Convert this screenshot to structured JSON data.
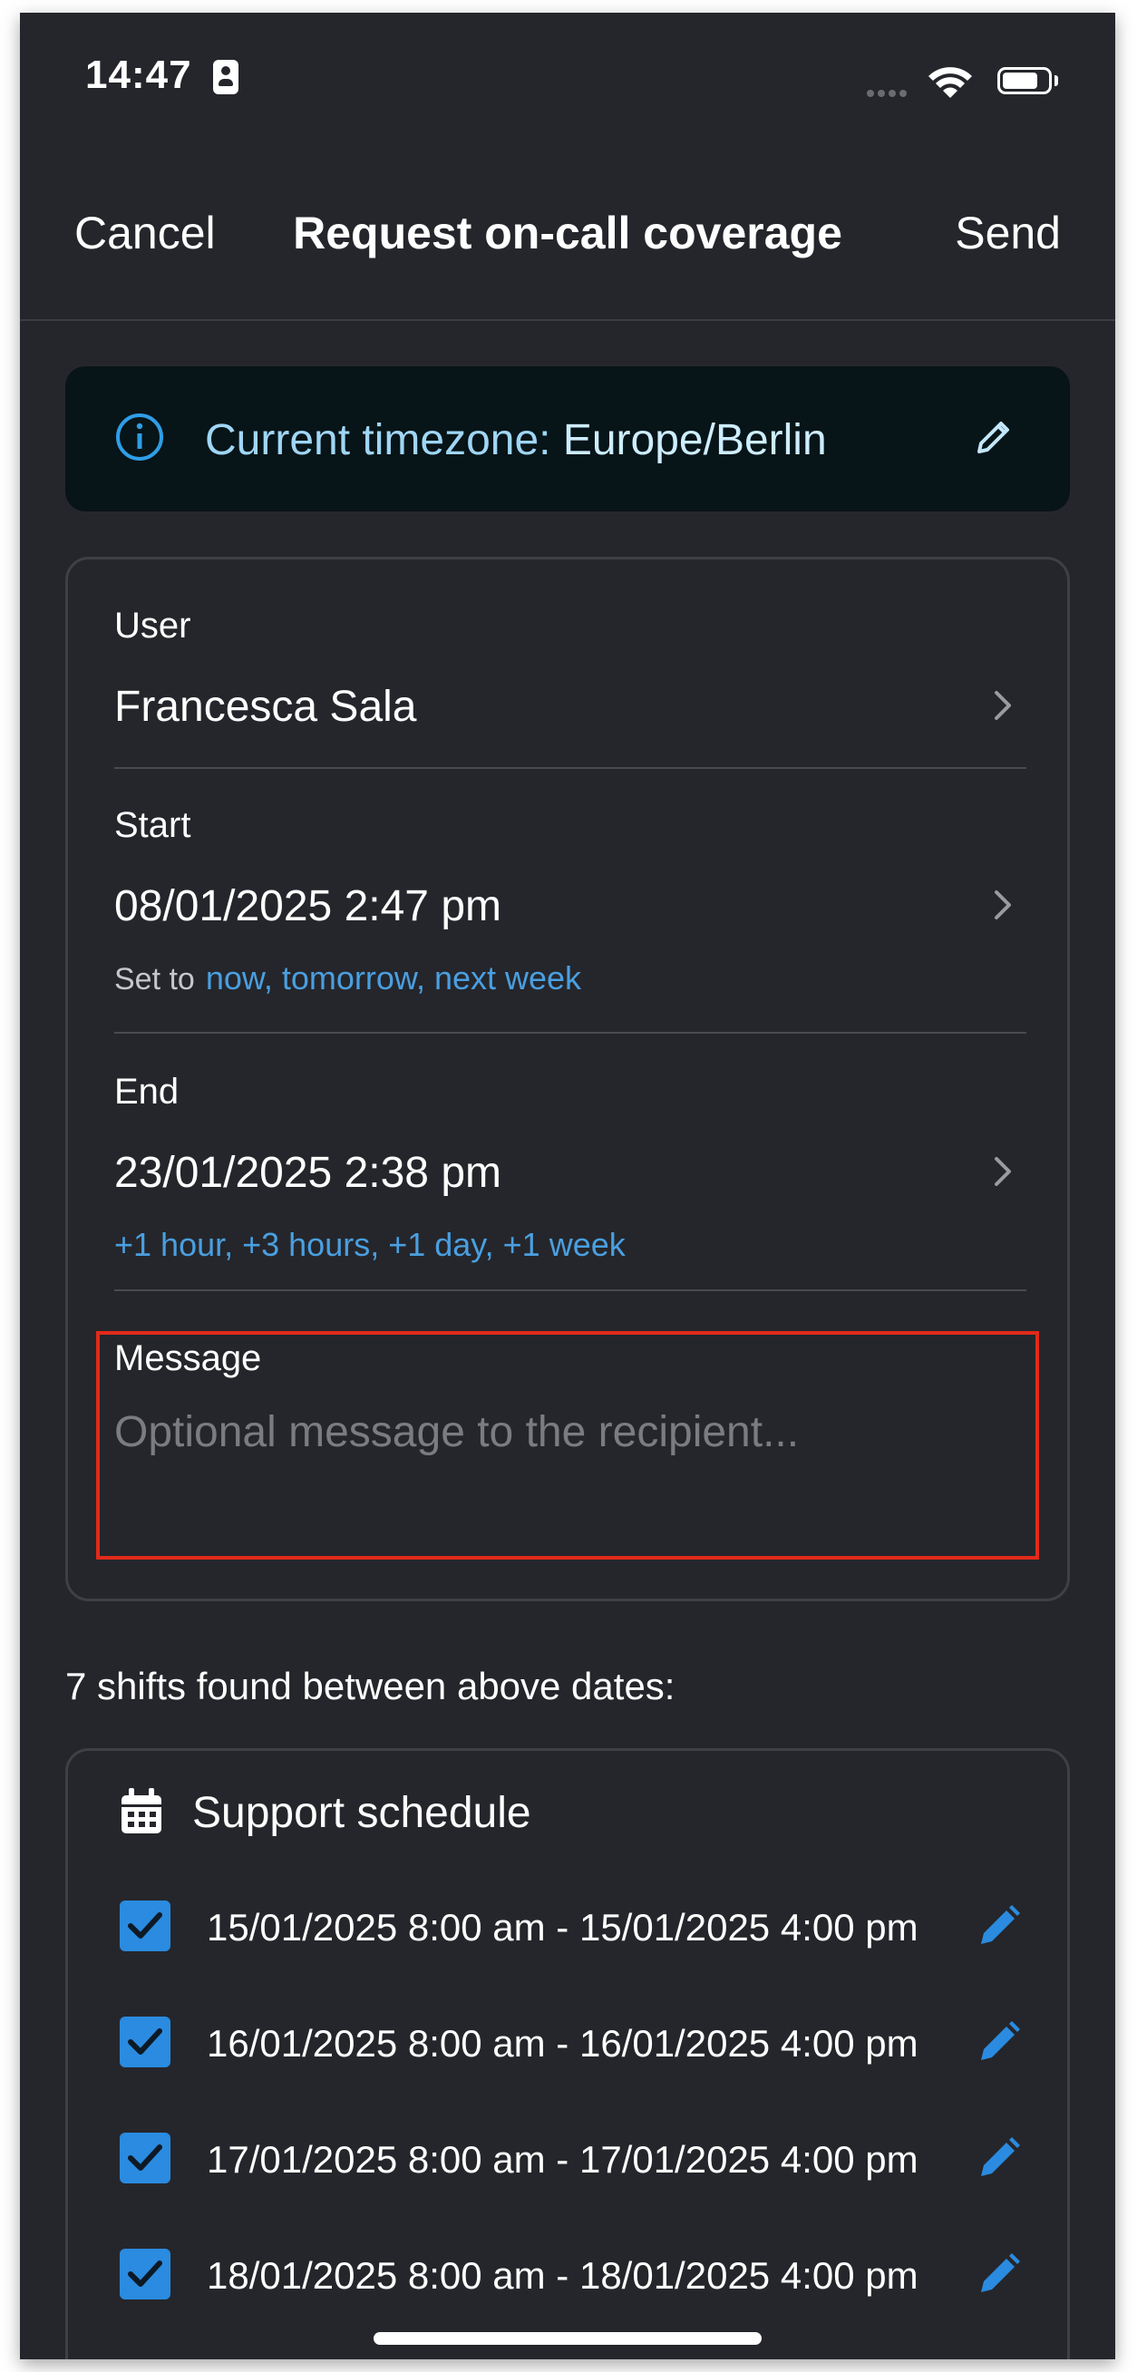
{
  "status_bar": {
    "time": "14:47"
  },
  "nav": {
    "cancel": "Cancel",
    "title": "Request on-call coverage",
    "send": "Send"
  },
  "timezone_banner": {
    "prefix": "Current timezone: ",
    "zone": "Europe/Berlin"
  },
  "form": {
    "user": {
      "label": "User",
      "value": "Francesca Sala"
    },
    "start": {
      "label": "Start",
      "value": "08/01/2025 2:47 pm",
      "set_to": "Set to",
      "quick_options": "now, tomorrow, next week"
    },
    "end": {
      "label": "End",
      "value": "23/01/2025 2:38 pm",
      "quick_options": "+1 hour, +3 hours, +1 day, +1 week"
    },
    "message": {
      "label": "Message",
      "placeholder": "Optional message to the recipient..."
    }
  },
  "shifts_caption": "7 shifts found between above dates:",
  "schedule": {
    "title": "Support schedule",
    "shifts": [
      "15/01/2025 8:00 am - 15/01/2025 4:00 pm",
      "16/01/2025 8:00 am - 16/01/2025 4:00 pm",
      "17/01/2025 8:00 am - 17/01/2025 4:00 pm",
      "18/01/2025 8:00 am - 18/01/2025 4:00 pm"
    ]
  },
  "colors": {
    "background": "#25262b",
    "accent": "#2a8be0",
    "highlight_border": "#e12a1a",
    "banner": "#071418"
  }
}
